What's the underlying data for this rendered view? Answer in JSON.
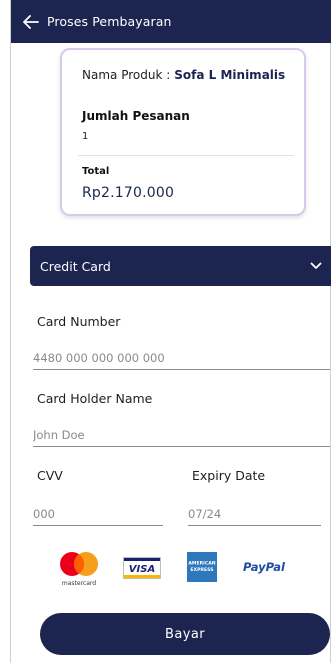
{
  "header": {
    "title": "Proses Pembayaran"
  },
  "summary": {
    "product_label": "Nama Produk :",
    "product_value": "Sofa L Minimalis",
    "quantity_label": "Jumlah Pesanan",
    "quantity_value": "1",
    "total_label": "Total",
    "total_value": "Rp2.170.000"
  },
  "payment_method": {
    "selected": "Credit Card"
  },
  "form": {
    "card_number_label": "Card Number",
    "card_number_placeholder": "4480 000 000 000 000",
    "holder_label": "Card Holder Name",
    "holder_placeholder": "John Doe",
    "cvv_label": "CVV",
    "cvv_placeholder": "000",
    "expiry_label": "Expiry Date",
    "expiry_placeholder": "07/24"
  },
  "logos": {
    "mastercard_text": "mastercard",
    "visa_text": "VISA",
    "amex_text_top": "AMERICAN",
    "amex_text_bottom": "EXPRESS",
    "paypal_text": "PayPal"
  },
  "actions": {
    "pay_label": "Bayar"
  },
  "colors": {
    "primary": "#1c2550",
    "card_border": "#d9c9ef"
  }
}
